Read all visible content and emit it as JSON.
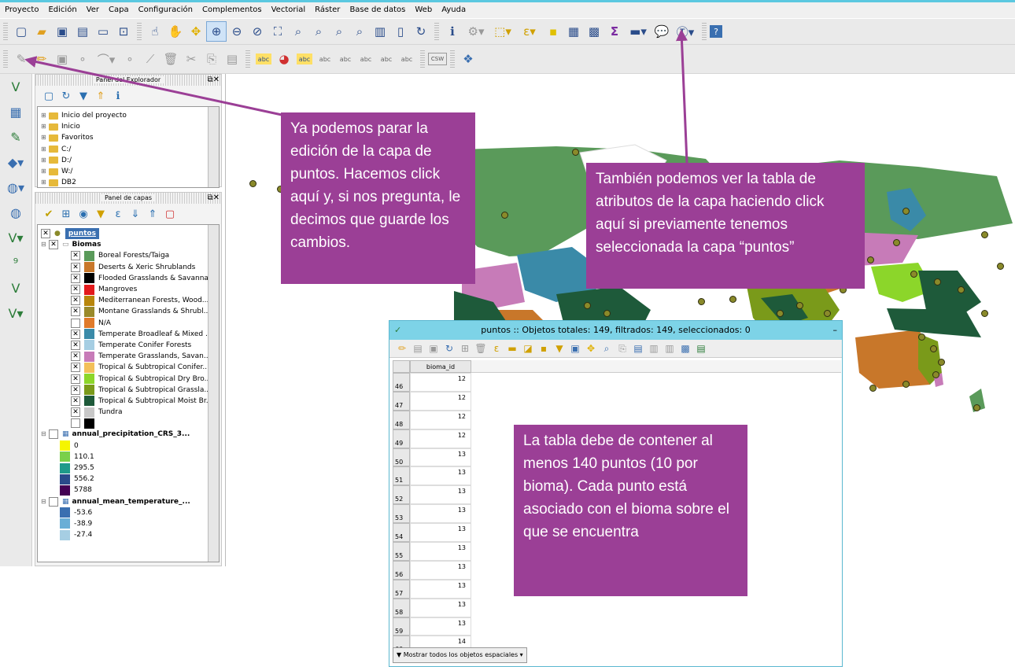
{
  "menu": [
    "Proyecto",
    "Edición",
    "Ver",
    "Capa",
    "Configuración",
    "Complementos",
    "Vectorial",
    "Ráster",
    "Base de datos",
    "Web",
    "Ayuda"
  ],
  "browser_panel": {
    "title": "Panel del Explorador",
    "items": [
      "Inicio del proyecto",
      "Inicio",
      "Favoritos",
      "C:/",
      "D:/",
      "W:/",
      "DB2"
    ]
  },
  "layers_panel": {
    "title": "Panel de capas",
    "puntos": "puntos",
    "biomas": "Biomas",
    "legend": [
      {
        "label": "Boreal Forests/Taiga",
        "color": "#5a9a5a"
      },
      {
        "label": "Deserts & Xeric Shrublands",
        "color": "#c8772a"
      },
      {
        "label": "Flooded Grasslands & Savannas",
        "color": "#000000"
      },
      {
        "label": "Mangroves",
        "color": "#e31a1c"
      },
      {
        "label": "Mediterranean Forests, Wood...",
        "color": "#b8860b"
      },
      {
        "label": "Montane Grasslands & Shrubl...",
        "color": "#9a8a2a"
      },
      {
        "label": "N/A",
        "color": "#e07a2a"
      },
      {
        "label": "Temperate Broadleaf & Mixed ...",
        "color": "#3a8aa8"
      },
      {
        "label": "Temperate Conifer Forests",
        "color": "#a6cee3"
      },
      {
        "label": "Temperate Grasslands, Savan...",
        "color": "#c77bb8"
      },
      {
        "label": "Tropical & Subtropical Conifer...",
        "color": "#f3c05a"
      },
      {
        "label": "Tropical & Subtropical Dry Bro...",
        "color": "#8cd62a"
      },
      {
        "label": "Tropical & Subtropical Grassla...",
        "color": "#7a9a1a"
      },
      {
        "label": "Tropical & Subtropical Moist Br...",
        "color": "#1e5a3a"
      },
      {
        "label": "Tundra",
        "color": "#c8c8c8"
      },
      {
        "label": "",
        "color": "#000000"
      }
    ],
    "precip_layer": "annual_precipitation_CRS_3...",
    "precip_legend": [
      {
        "label": "0",
        "color": "#f5f500"
      },
      {
        "label": "110.1",
        "color": "#7ad04a"
      },
      {
        "label": "295.5",
        "color": "#1f9a8a"
      },
      {
        "label": "556.2",
        "color": "#2a4a8a"
      },
      {
        "label": "5788",
        "color": "#440154"
      }
    ],
    "temp_layer": "annual_mean_temperature_...",
    "temp_legend": [
      {
        "label": "-53.6",
        "color": "#3a6fb0"
      },
      {
        "label": "-38.9",
        "color": "#6aaed6"
      },
      {
        "label": "-27.4",
        "color": "#a6cee3"
      }
    ]
  },
  "callouts": {
    "stop_edit": "Ya podemos parar la edición de la capa de puntos. Hacemos click aquí y, si nos pregunta, le decimos que guarde los cambios.",
    "attr_table": "También podemos ver la tabla de atributos de la capa haciendo click aquí si previamente tenemos seleccionada la capa “puntos”",
    "table_note": "La tabla debe de contener al menos 140 puntos (10 por bioma). Cada punto está asociado con el bioma sobre el que se encuentra"
  },
  "attribute_table": {
    "title": "puntos :: Objetos totales: 149, filtrados: 149, seleccionados: 0",
    "column": "bioma_id",
    "rows": [
      {
        "n": "46",
        "v": "12"
      },
      {
        "n": "47",
        "v": "12"
      },
      {
        "n": "48",
        "v": "12"
      },
      {
        "n": "49",
        "v": "12"
      },
      {
        "n": "50",
        "v": "13"
      },
      {
        "n": "51",
        "v": "13"
      },
      {
        "n": "52",
        "v": "13"
      },
      {
        "n": "53",
        "v": "13"
      },
      {
        "n": "54",
        "v": "13"
      },
      {
        "n": "55",
        "v": "13"
      },
      {
        "n": "56",
        "v": "13"
      },
      {
        "n": "57",
        "v": "13"
      },
      {
        "n": "58",
        "v": "13"
      },
      {
        "n": "59",
        "v": "13"
      },
      {
        "n": "60",
        "v": "14"
      }
    ],
    "footer": "Mostrar todos los objetos espaciales"
  },
  "toolbar_labels": {
    "abc": "abc",
    "csw": "CSW"
  }
}
